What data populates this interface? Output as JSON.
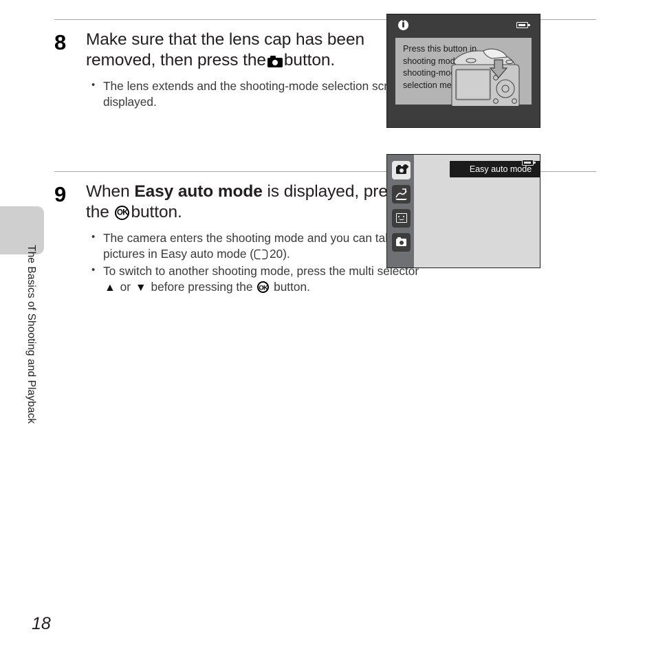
{
  "page": {
    "number": "18",
    "chapter_label": "The Basics of Shooting and Playback"
  },
  "steps": [
    {
      "number": "8",
      "heading_part1": "Make sure that the lens cap has been removed, then press the",
      "heading_icon": "camera-icon",
      "heading_part2": "button.",
      "bullets": [
        "The lens extends and the shooting-mode selection screen is displayed."
      ]
    },
    {
      "number": "9",
      "heading_part1": "When",
      "heading_bold": "Easy auto mode",
      "heading_part2": "is displayed, press the",
      "heading_icon": "ok-button-icon",
      "heading_part3": "button.",
      "bullets": [
        {
          "text_before": "The camera enters the shooting mode and you can take pictures in Easy auto mode (",
          "icon": "book-icon",
          "page_ref": "20",
          "text_after": ")."
        },
        {
          "text_before": "To switch to another shooting mode, press the multi selector",
          "icon_up": "▲",
          "or_text": "or",
          "icon_down": "▼",
          "text_mid": "before pressing the",
          "icon_ok": "ok-button-icon",
          "text_after": "button."
        }
      ]
    }
  ],
  "lcd_step8": {
    "info_icon": "info-icon",
    "battery_icon": "battery-icon",
    "message": "Press this button in shooting mode for shooting-mode selection menu.",
    "illustration": "camera-rear-view-with-arrow"
  },
  "lcd_step9": {
    "title": "Easy auto mode",
    "battery_icon": "battery-icon",
    "mode_icons": [
      {
        "name": "easy-auto-mode-icon",
        "active": true
      },
      {
        "name": "scene-mode-icon",
        "active": false
      },
      {
        "name": "smart-portrait-mode-icon",
        "active": false
      },
      {
        "name": "auto-mode-icon",
        "active": false
      }
    ]
  },
  "colors": {
    "rule": "#a6a6a6",
    "chapter_tab": "#cfcfcf",
    "lcd_frame": "#1b1b1b",
    "lcd_bar": "#3d3d3d",
    "lcd_panel": "#b4b4b4",
    "lcd_rail": "#6e7073",
    "lcd_main": "#d9d9d9"
  }
}
